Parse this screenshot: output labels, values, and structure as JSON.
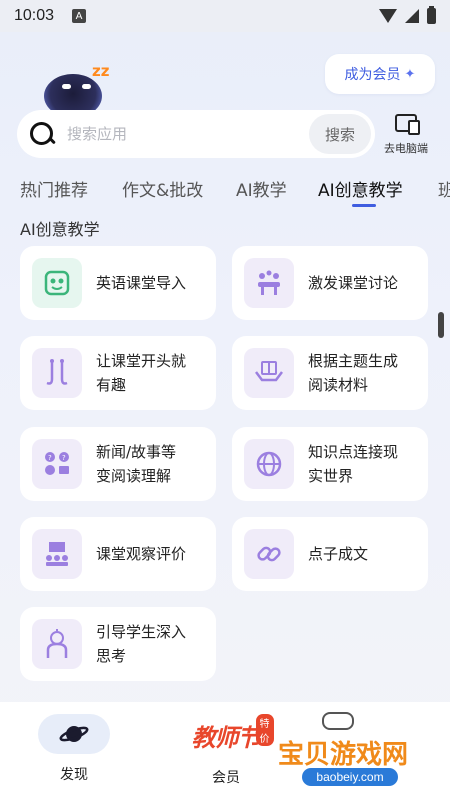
{
  "status": {
    "time": "10:03",
    "notif_letter": "A"
  },
  "header": {
    "member_button": "成为会员",
    "pc_label": "去电脑端"
  },
  "search": {
    "placeholder": "搜索应用",
    "button": "搜索"
  },
  "tabs": [
    {
      "label": "热门推荐"
    },
    {
      "label": "作文&批改"
    },
    {
      "label": "AI教学"
    },
    {
      "label": "AI创意教学",
      "active": true
    },
    {
      "label": "班"
    }
  ],
  "section": {
    "title": "AI创意教学"
  },
  "cards": [
    {
      "line1": "英语课堂导入",
      "line2": "",
      "icon": "robot-face-icon"
    },
    {
      "line1": "激发课堂讨论",
      "line2": "",
      "icon": "discussion-icon"
    },
    {
      "line1": "让课堂开头就",
      "line2": "有趣",
      "icon": "hooks-icon"
    },
    {
      "line1": "根据主题生成",
      "line2": "阅读材料",
      "icon": "book-hands-icon"
    },
    {
      "line1": "新闻/故事等",
      "line2": "变阅读理解",
      "icon": "question-people-icon"
    },
    {
      "line1": "知识点连接现",
      "line2": "实世界",
      "icon": "globe-icon"
    },
    {
      "line1": "课堂观察评价",
      "line2": "",
      "icon": "classroom-icon"
    },
    {
      "line1": "点子成文",
      "line2": "",
      "icon": "link-icon"
    },
    {
      "line1": "引导学生深入",
      "line2": "思考",
      "icon": "lightbulb-head-icon"
    }
  ],
  "bottom_nav": {
    "discover_label": "发现",
    "member_label": "会员",
    "promo_text": "教师节",
    "promo_badge": "特价"
  },
  "watermark": {
    "text": "宝贝游戏网",
    "url": "baobeiy.com"
  },
  "colors": {
    "accent": "#3f5de0",
    "icon_purple": "#9b7fe0",
    "icon_green": "#3bb57a",
    "promo_red": "#e8462b"
  }
}
